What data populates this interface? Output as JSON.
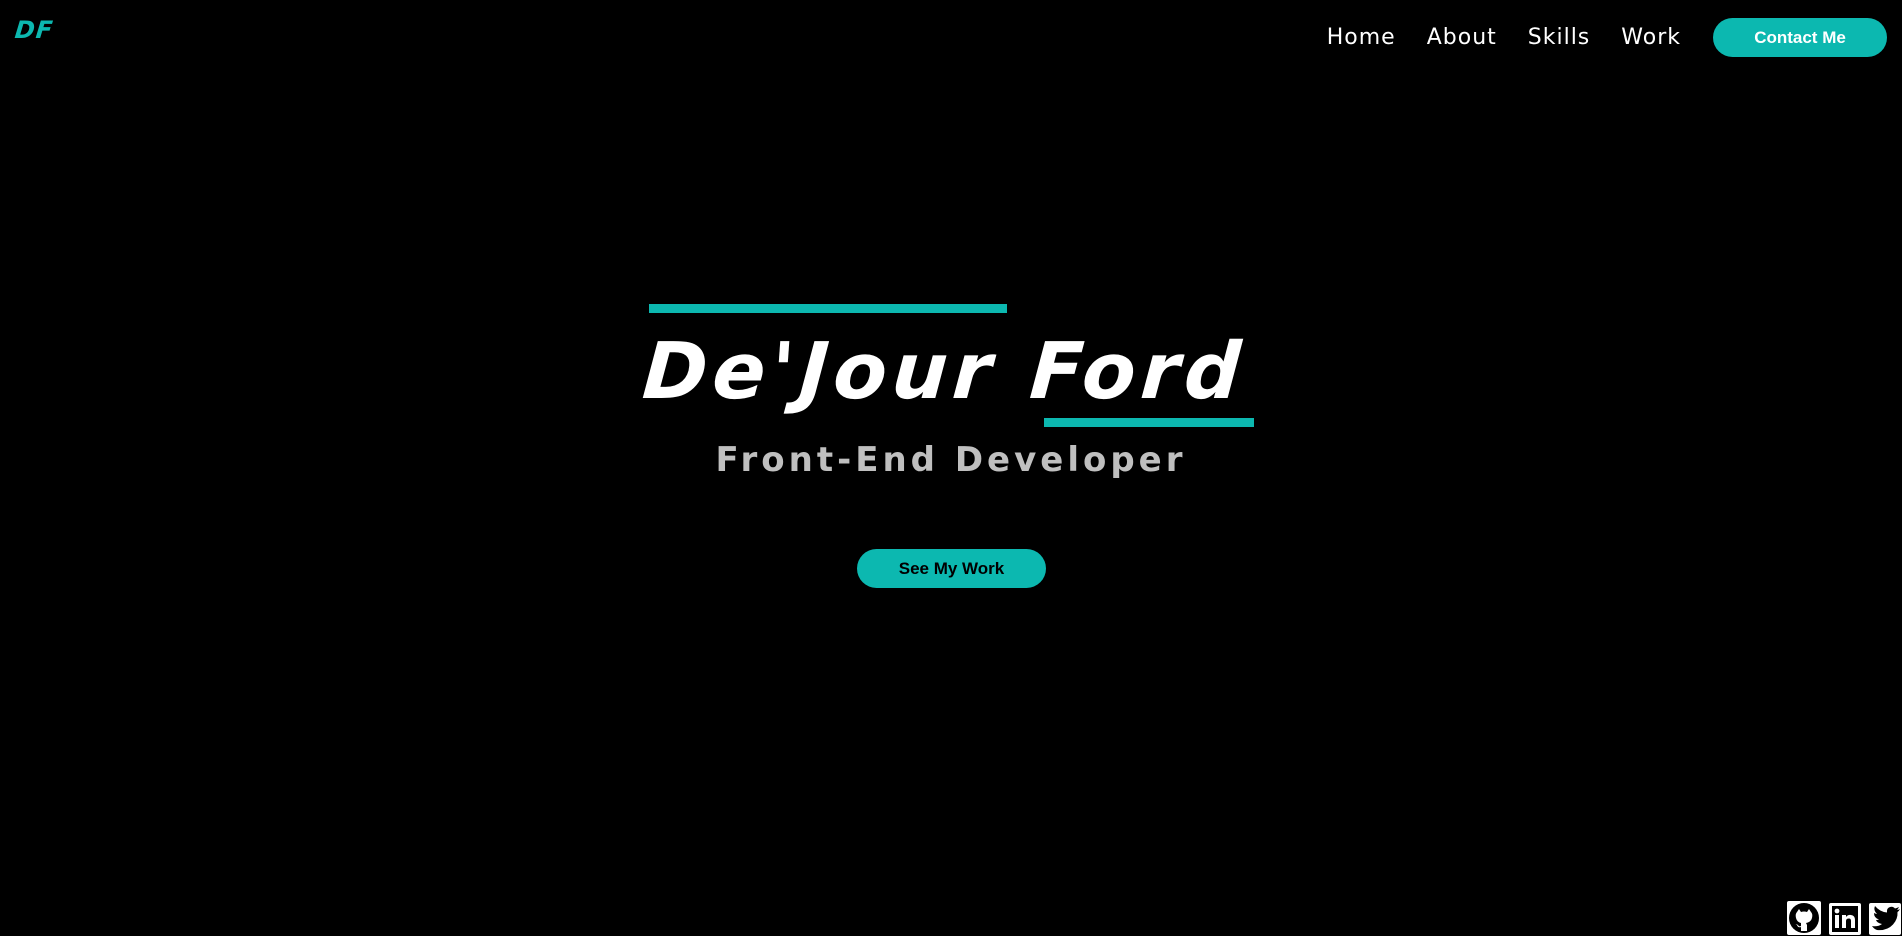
{
  "logo": {
    "text": "DF"
  },
  "nav": {
    "links": [
      {
        "label": "Home"
      },
      {
        "label": "About"
      },
      {
        "label": "Skills"
      },
      {
        "label": "Work"
      }
    ],
    "contact_label": "Contact Me"
  },
  "hero": {
    "first_name": "De'Jour",
    "last_name": "Ford",
    "subtitle": "Front-End Developer",
    "cta_label": "See My Work"
  },
  "socials": [
    {
      "icon": "github-icon"
    },
    {
      "icon": "linkedin-icon"
    },
    {
      "icon": "twitter-icon"
    }
  ],
  "colors": {
    "background": "#000000",
    "accent": "#0cb8b0",
    "text": "#ffffff",
    "subtitle": "#bfbfbf"
  }
}
